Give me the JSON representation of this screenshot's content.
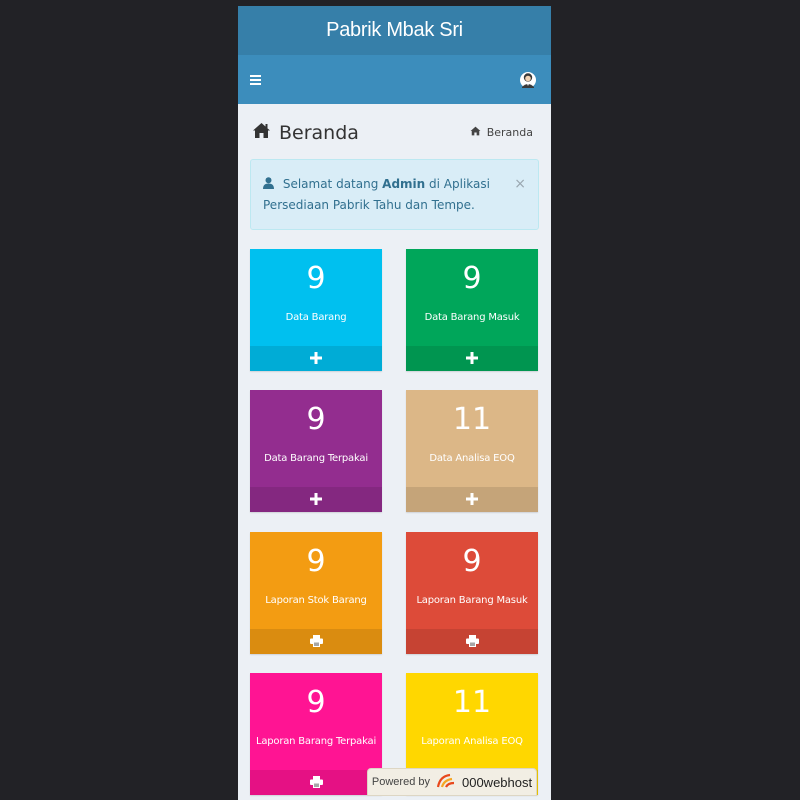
{
  "app": {
    "title": "Pabrik Mbak Sri"
  },
  "header": {
    "page_title": "Beranda",
    "breadcrumb": "Beranda"
  },
  "alert": {
    "prefix": "Selamat datang ",
    "user": "Admin",
    "suffix": " di Aplikasi Persediaan Pabrik Tahu dan Tempe.",
    "close": "×"
  },
  "tiles": [
    {
      "value": "9",
      "label": "Data Barang",
      "color": "#00c0ef",
      "icon": "plus-icon"
    },
    {
      "value": "9",
      "label": "Data Barang Masuk",
      "color": "#00a65a",
      "icon": "plus-icon"
    },
    {
      "value": "9",
      "label": "Data Barang Terpakai",
      "color": "#932d8f",
      "icon": "plus-icon"
    },
    {
      "value": "11",
      "label": "Data Analisa EOQ",
      "color": "#dcb787",
      "icon": "plus-icon"
    },
    {
      "value": "9",
      "label": "Laporan Stok Barang",
      "color": "#f39c12",
      "icon": "print-icon"
    },
    {
      "value": "9",
      "label": "Laporan Barang Masuk",
      "color": "#dd4b39",
      "icon": "print-icon"
    },
    {
      "value": "9",
      "label": "Laporan Barang Terpakai",
      "color": "#ff1493",
      "icon": "print-icon"
    },
    {
      "value": "11",
      "label": "Laporan Analisa EOQ",
      "color": "#ffd700",
      "icon": "print-icon"
    }
  ],
  "powered_by": {
    "prefix": "Powered by",
    "brand": "000webhost"
  },
  "colors": {
    "logo_bg": "#367fa9",
    "navbar_bg": "#3c8dbc",
    "content_bg": "#ecf0f5",
    "page_bg": "#222226"
  }
}
